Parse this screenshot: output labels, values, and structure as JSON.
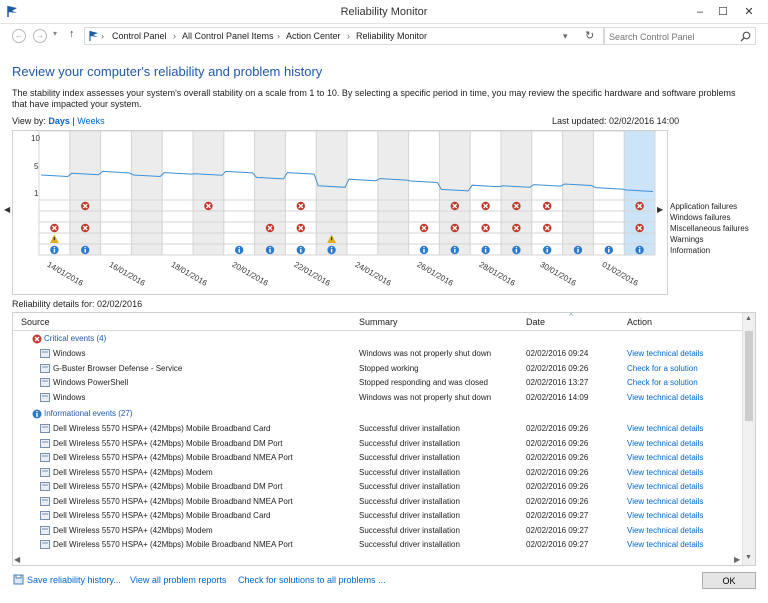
{
  "window": {
    "title": "Reliability Monitor",
    "minimize": "–",
    "maximize": "☐",
    "close": "✕"
  },
  "address": {
    "crumbs": [
      "Control Panel",
      "All Control Panel Items",
      "Action Center",
      "Reliability Monitor"
    ],
    "search_placeholder": "Search Control Panel"
  },
  "header": {
    "title": "Review your computer's reliability and problem history",
    "description": "The stability index assesses your system's overall stability on a scale from 1 to 10. By selecting a specific period in time, you may review the specific hardware and software problems that have impacted your system.",
    "view_by_label": "View by:",
    "view_days": "Days",
    "view_sep": "|",
    "view_weeks": "Weeks",
    "last_updated": "Last updated: 02/02/2016 14:00"
  },
  "chart_data": {
    "type": "line",
    "y_ticks": [
      "10",
      "5",
      "1"
    ],
    "ylim": [
      1,
      10
    ],
    "columns": 20,
    "selected_column": 19,
    "stability": [
      4.0,
      4.3,
      4.6,
      4.0,
      4.4,
      4.2,
      4.6,
      3.6,
      4.4,
      2.2,
      3.3,
      3.4,
      3.0,
      1.6,
      2.3,
      2.2,
      2.4,
      2.5,
      1.9,
      1.5
    ],
    "categories": [
      "Application failures",
      "Windows failures",
      "Miscellaneous failures",
      "Warnings",
      "Information"
    ],
    "events": {
      "application_failures": [
        1,
        5,
        8,
        13,
        14,
        15,
        16,
        19
      ],
      "windows_failures": [],
      "misc_failures": [
        0,
        1,
        7,
        8,
        12,
        13,
        14,
        15,
        16,
        19
      ],
      "warnings": [
        0,
        9
      ],
      "information": [
        0,
        1,
        6,
        7,
        8,
        9,
        12,
        13,
        14,
        15,
        16,
        17,
        18,
        19
      ]
    },
    "date_labels": [
      "14/01/2016",
      "16/01/2016",
      "18/01/2016",
      "20/01/2016",
      "22/01/2016",
      "24/01/2016",
      "26/01/2016",
      "28/01/2016",
      "30/01/2016",
      "01/02/2016"
    ]
  },
  "details": {
    "title": "Reliability details for: 02/02/2016",
    "columns": {
      "source": "Source",
      "summary": "Summary",
      "date": "Date",
      "action": "Action"
    },
    "groups": [
      {
        "label": "Critical events (4)",
        "rows": [
          {
            "source": "Windows",
            "summary": "Windows was not properly shut down",
            "date": "02/02/2016 09:24",
            "action": "View  technical details"
          },
          {
            "source": "G-Buster Browser Defense - Service",
            "summary": "Stopped working",
            "date": "02/02/2016 09:26",
            "action": "Check for a solution"
          },
          {
            "source": "Windows PowerShell",
            "summary": "Stopped responding and was closed",
            "date": "02/02/2016 13:27",
            "action": "Check for a solution"
          },
          {
            "source": "Windows",
            "summary": "Windows was not properly shut down",
            "date": "02/02/2016 14:09",
            "action": "View  technical details"
          }
        ]
      },
      {
        "label": "Informational events (27)",
        "rows": [
          {
            "source": "Dell Wireless 5570 HSPA+ (42Mbps) Mobile Broadband Card",
            "summary": "Successful driver installation",
            "date": "02/02/2016 09:26",
            "action": "View  technical details"
          },
          {
            "source": "Dell Wireless 5570 HSPA+ (42Mbps) Mobile Broadband DM Port",
            "summary": "Successful driver installation",
            "date": "02/02/2016 09:26",
            "action": "View  technical details"
          },
          {
            "source": "Dell Wireless 5570 HSPA+ (42Mbps) Mobile Broadband NMEA Port",
            "summary": "Successful driver installation",
            "date": "02/02/2016 09:26",
            "action": "View  technical details"
          },
          {
            "source": "Dell Wireless 5570 HSPA+ (42Mbps) Modem",
            "summary": "Successful driver installation",
            "date": "02/02/2016 09:26",
            "action": "View  technical details"
          },
          {
            "source": "Dell Wireless 5570 HSPA+ (42Mbps) Mobile Broadband DM Port",
            "summary": "Successful driver installation",
            "date": "02/02/2016 09:26",
            "action": "View  technical details"
          },
          {
            "source": "Dell Wireless 5570 HSPA+ (42Mbps) Mobile Broadband NMEA Port",
            "summary": "Successful driver installation",
            "date": "02/02/2016 09:26",
            "action": "View  technical details"
          },
          {
            "source": "Dell Wireless 5570 HSPA+ (42Mbps) Mobile Broadband Card",
            "summary": "Successful driver installation",
            "date": "02/02/2016 09:27",
            "action": "View  technical details"
          },
          {
            "source": "Dell Wireless 5570 HSPA+ (42Mbps) Modem",
            "summary": "Successful driver installation",
            "date": "02/02/2016 09:27",
            "action": "View  technical details"
          },
          {
            "source": "Dell Wireless 5570 HSPA+ (42Mbps) Mobile Broadband NMEA Port",
            "summary": "Successful driver installation",
            "date": "02/02/2016 09:27",
            "action": "View  technical details"
          }
        ]
      }
    ]
  },
  "footer": {
    "save_history": "Save reliability history...",
    "view_all": "View all problem reports",
    "check_solutions": "Check for solutions to all problems ...",
    "ok": "OK"
  },
  "colors": {
    "link": "#0066cc",
    "title": "#1e5aa8",
    "line": "#3c8fd6",
    "error": "#c0392b",
    "warning": "#e0b020",
    "info": "#2a7ad0",
    "selected": "#cce4f7",
    "shaded": "#ececec"
  }
}
